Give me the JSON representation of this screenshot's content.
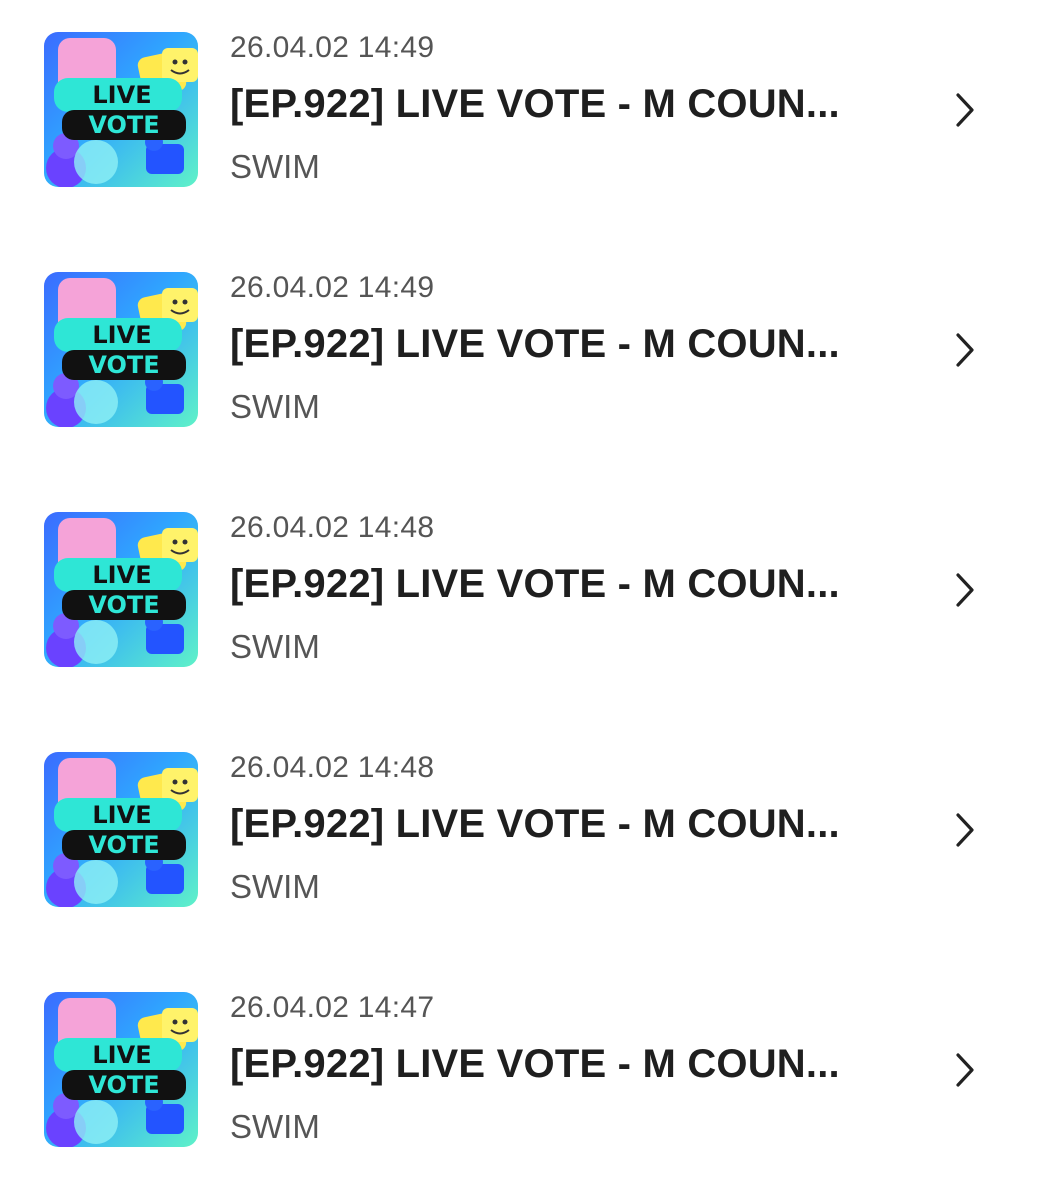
{
  "items": [
    {
      "date": "26.04.02 14:49",
      "title": "[EP.922] LIVE VOTE - M COUN...",
      "source": "SWIM",
      "thumb_line1": "LIVE",
      "thumb_line2": "VOTE"
    },
    {
      "date": "26.04.02 14:49",
      "title": "[EP.922] LIVE VOTE - M COUN...",
      "source": "SWIM",
      "thumb_line1": "LIVE",
      "thumb_line2": "VOTE"
    },
    {
      "date": "26.04.02 14:48",
      "title": "[EP.922] LIVE VOTE - M COUN...",
      "source": "SWIM",
      "thumb_line1": "LIVE",
      "thumb_line2": "VOTE"
    },
    {
      "date": "26.04.02 14:48",
      "title": "[EP.922] LIVE VOTE - M COUN...",
      "source": "SWIM",
      "thumb_line1": "LIVE",
      "thumb_line2": "VOTE"
    },
    {
      "date": "26.04.02 14:47",
      "title": "[EP.922] LIVE VOTE - M COUN...",
      "source": "SWIM",
      "thumb_line1": "LIVE",
      "thumb_line2": "VOTE"
    }
  ],
  "icons": {
    "thumbnail": "live-vote-thumbnail",
    "chevron": "chevron-right-icon"
  },
  "colors": {
    "title": "#1f1f1f",
    "meta": "#555555",
    "thumb_teal": "#2ee6d6",
    "thumb_black": "#111111",
    "thumb_blue": "#2a6cff"
  }
}
